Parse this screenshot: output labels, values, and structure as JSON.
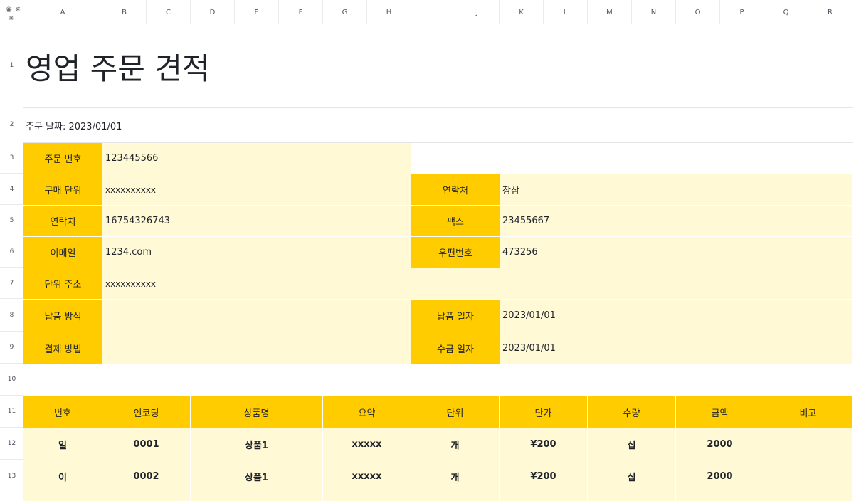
{
  "columns": [
    "A",
    "B",
    "C",
    "D",
    "E",
    "F",
    "G",
    "H",
    "I",
    "J",
    "K",
    "L",
    "M",
    "N",
    "O",
    "P",
    "Q",
    "R"
  ],
  "rows": [
    "1",
    "2",
    "3",
    "4",
    "5",
    "6",
    "7",
    "8",
    "9",
    "10",
    "11",
    "12",
    "13"
  ],
  "corner_icons": [
    "eye-icon",
    "freeze-icon"
  ],
  "title": "영업 주문 견적",
  "order_date": "주문 날짜: 2023/01/01",
  "info": {
    "order_no_label": "주문 번호",
    "order_no": "123445566",
    "buyer_label": "구매 단위",
    "buyer": "xxxxxxxxxx",
    "contact_label_left": "연락처",
    "contact_phone": "16754326743",
    "email_label": "이메일",
    "email": "1234.com",
    "address_label": "단위 주소",
    "address": "xxxxxxxxxx",
    "delivery_method_label": "납품 방식",
    "delivery_method": "",
    "payment_method_label": "결제 방법",
    "payment_method": "",
    "contact_label_right": "연락처",
    "contact_person": "장삼",
    "fax_label": "팩스",
    "fax": "23455667",
    "postal_label": "우편번호",
    "postal": "473256",
    "delivery_date_label": "납품 일자",
    "delivery_date": "2023/01/01",
    "payment_date_label": "수금 일자",
    "payment_date": "2023/01/01"
  },
  "table": {
    "headers": [
      "번호",
      "인코딩",
      "상품명",
      "요약",
      "단위",
      "단가",
      "수량",
      "금액",
      "비고"
    ],
    "rows": [
      [
        "일",
        "0001",
        "상품1",
        "xxxxx",
        "개",
        "¥200",
        "십",
        "2000",
        ""
      ],
      [
        "이",
        "0002",
        "상품1",
        "xxxxx",
        "개",
        "¥200",
        "십",
        "2000",
        ""
      ]
    ]
  }
}
